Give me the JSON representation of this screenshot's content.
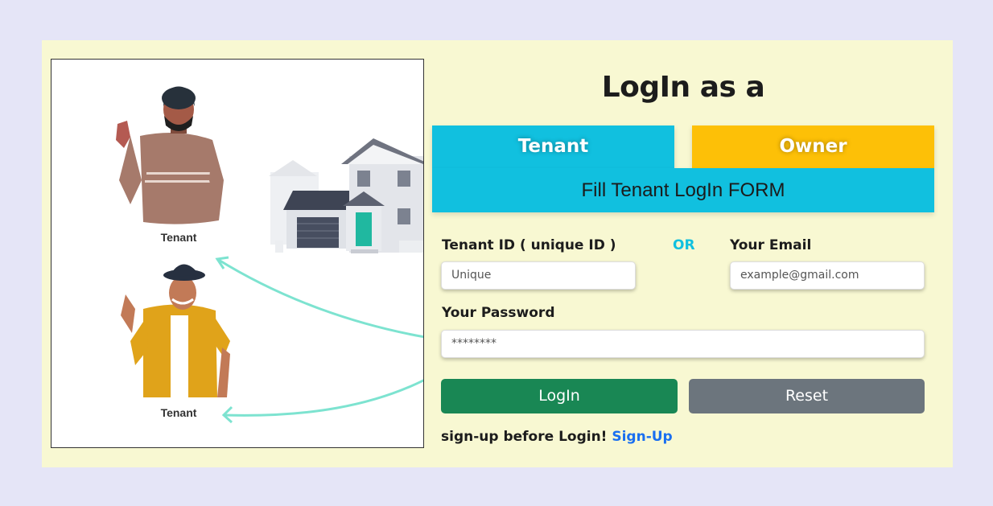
{
  "illustration": {
    "person1_label": "Tenant",
    "person2_label": "Tenant"
  },
  "heading": "LogIn as a",
  "tabs": {
    "tenant": "Tenant",
    "owner": "Owner"
  },
  "banner": "Fill Tenant LogIn FORM",
  "form": {
    "tenant_id_label": "Tenant ID ( unique ID )",
    "or_label": "OR",
    "email_label": "Your Email",
    "tenant_id_placeholder": "Unique",
    "email_placeholder": "example@gmail.com",
    "password_label": "Your Password",
    "password_placeholder": "********"
  },
  "buttons": {
    "login": "LogIn",
    "reset": "Reset"
  },
  "signup": {
    "text": "sign-up before Login!",
    "link": "Sign-Up"
  },
  "colors": {
    "page_bg": "#e5e5f7",
    "card_bg": "#f8f8d2",
    "tenant_tab": "#11c0df",
    "owner_tab": "#fdc007",
    "login_button": "#198754",
    "reset_button": "#6c757d",
    "link": "#1a6ff0"
  }
}
